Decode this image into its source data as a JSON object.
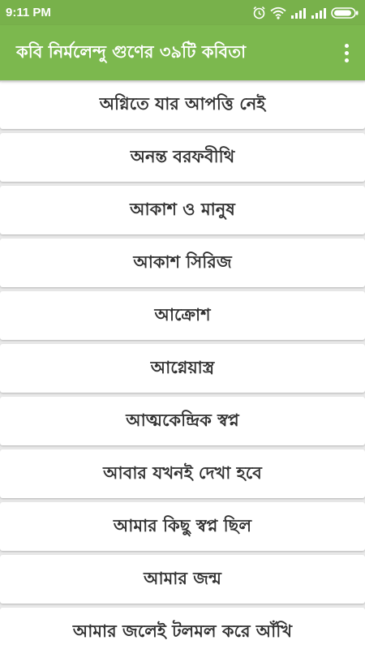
{
  "status_bar": {
    "time": "9:11 PM",
    "icons": [
      "alarm-icon",
      "wifi-icon",
      "signal-icon",
      "signal-icon",
      "battery-icon"
    ]
  },
  "app_bar": {
    "title": "কবি নির্মলেন্দু গুণের ৩৯টি কবিতা",
    "menu_icon": "overflow-menu-icon"
  },
  "poems": [
    "অগ্নিতে যার আপত্তি নেই",
    "অনন্ত বরফবীথি",
    "আকাশ ও মানুষ",
    "আকাশ সিরিজ",
    "আক্রোশ",
    "আগ্নেয়াস্ত্র",
    "আত্মকেন্দ্রিক স্বপ্ন",
    "আবার যখনই দেখা হবে",
    "আমার কিছু স্বপ্ন ছিল",
    "আমার জন্ম",
    "আমার জলেই টলমল করে আঁখি"
  ],
  "colors": {
    "status_bar": "#78b14b",
    "app_bar": "#7cb84e",
    "list_background": "#e9e9e9",
    "item_background": "#ffffff",
    "item_text": "#333333"
  }
}
